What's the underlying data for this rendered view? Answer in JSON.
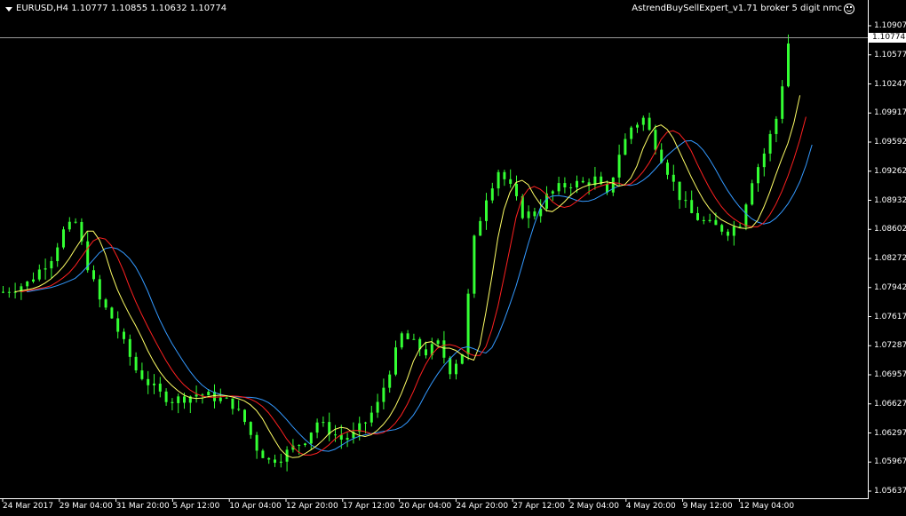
{
  "header": {
    "symbol_info": "EURUSD,H4  1.10777 1.10855 1.10632 1.10774",
    "expert_label": "AstrendBuySellExpert_v1.71 broker 5 digit nmc",
    "expert_icon": "smiley-icon"
  },
  "current_price": "1.10774",
  "price_axis": [
    "1.10907",
    "1.10577",
    "1.10247",
    "1.09917",
    "1.09592",
    "1.09262",
    "1.08932",
    "1.08602",
    "1.08272",
    "1.07942",
    "1.07617",
    "1.07287",
    "1.06957",
    "1.06627",
    "1.06297",
    "1.05967",
    "1.05637"
  ],
  "time_axis": [
    "24 Mar 2017",
    "29 Mar 04:00",
    "31 Mar 20:00",
    "5 Apr 12:00",
    "10 Apr 04:00",
    "12 Apr 20:00",
    "17 Apr 12:00",
    "20 Apr 04:00",
    "24 Apr 20:00",
    "27 Apr 12:00",
    "2 May 04:00",
    "4 May 20:00",
    "9 May 12:00",
    "12 May 04:00"
  ],
  "colors": {
    "background": "#000000",
    "candles": "#33ff33",
    "ma_fast": "#ffff66",
    "ma_mid": "#ff2020",
    "ma_slow": "#3399ff",
    "grid_axis": "#ffffff"
  },
  "chart_data": {
    "type": "candlestick",
    "symbol": "EURUSD",
    "timeframe": "H4",
    "ylim": [
      1.0557,
      1.1097
    ],
    "close_path": [
      [
        0,
        1.079
      ],
      [
        4,
        1.08
      ],
      [
        8,
        1.083
      ],
      [
        10,
        1.086
      ],
      [
        12,
        1.087
      ],
      [
        14,
        1.082
      ],
      [
        16,
        1.078
      ],
      [
        18,
        1.076
      ],
      [
        20,
        1.073
      ],
      [
        22,
        1.07
      ],
      [
        24,
        1.0685
      ],
      [
        26,
        1.0672
      ],
      [
        28,
        1.0665
      ],
      [
        30,
        1.0668
      ],
      [
        32,
        1.0672
      ],
      [
        34,
        1.067
      ],
      [
        36,
        1.0666
      ],
      [
        38,
        1.066
      ],
      [
        40,
        1.064
      ],
      [
        42,
        1.061
      ],
      [
        44,
        1.0595
      ],
      [
        46,
        1.06
      ],
      [
        48,
        1.061
      ],
      [
        50,
        1.062
      ],
      [
        52,
        1.064
      ],
      [
        54,
        1.063
      ],
      [
        56,
        1.062
      ],
      [
        58,
        1.0625
      ],
      [
        60,
        1.064
      ],
      [
        62,
        1.066
      ],
      [
        64,
        1.07
      ],
      [
        66,
        1.074
      ],
      [
        68,
        1.073
      ],
      [
        70,
        1.072
      ],
      [
        72,
        1.073
      ],
      [
        74,
        1.07
      ],
      [
        76,
        1.072
      ],
      [
        78,
        1.085
      ],
      [
        80,
        1.09
      ],
      [
        82,
        1.093
      ],
      [
        84,
        1.091
      ],
      [
        86,
        1.088
      ],
      [
        88,
        1.088
      ],
      [
        90,
        1.09
      ],
      [
        92,
        1.091
      ],
      [
        94,
        1.0915
      ],
      [
        96,
        1.0915
      ],
      [
        98,
        1.092
      ],
      [
        100,
        1.09
      ],
      [
        102,
        1.095
      ],
      [
        104,
        1.098
      ],
      [
        106,
        1.099
      ],
      [
        108,
        1.096
      ],
      [
        110,
        1.093
      ],
      [
        112,
        1.09
      ],
      [
        114,
        1.088
      ],
      [
        116,
        1.087
      ],
      [
        118,
        1.0865
      ],
      [
        120,
        1.086
      ],
      [
        122,
        1.087
      ],
      [
        124,
        1.092
      ],
      [
        126,
        1.095
      ],
      [
        128,
        1.099
      ],
      [
        129,
        1.103
      ],
      [
        130,
        1.1077
      ]
    ],
    "indicators": [
      {
        "name": "MA fast",
        "color": "#ffff66"
      },
      {
        "name": "MA mid",
        "color": "#ff2020"
      },
      {
        "name": "MA slow",
        "color": "#3399ff"
      }
    ]
  }
}
